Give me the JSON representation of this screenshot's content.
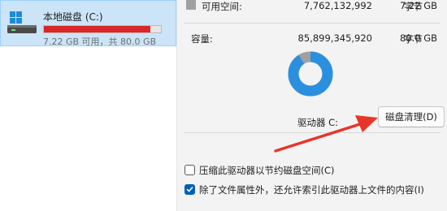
{
  "explorer": {
    "drive": {
      "name": "本地磁盘 (C:)",
      "free_text": "7.22 GB 可用，共 80.0 GB",
      "used_fraction": 0.91,
      "icon": "windows-drive-icon"
    }
  },
  "properties": {
    "free_space": {
      "label": "可用空间:",
      "bytes": "7,762,132,992",
      "unit": "字节",
      "gb": "7.22 GB",
      "color": "#a0a0a0"
    },
    "capacity": {
      "label": "容量:",
      "bytes": "85,899,345,920",
      "unit": "字节",
      "gb": "80.0 GB"
    },
    "donut": {
      "used_fraction": 0.91,
      "used_color": "#2b8fdf",
      "free_color": "#a0a0a0"
    },
    "drive_label": "驱动器 C:",
    "cleanup_button": "磁盘清理(D)",
    "options": [
      {
        "label": "压缩此驱动器以节约磁盘空间(C)",
        "checked": false
      },
      {
        "label": "除了文件属性外，还允许索引此驱动器上文件的内容(I)",
        "checked": true
      }
    ]
  },
  "annotation": {
    "arrow_color": "#e8352a"
  }
}
